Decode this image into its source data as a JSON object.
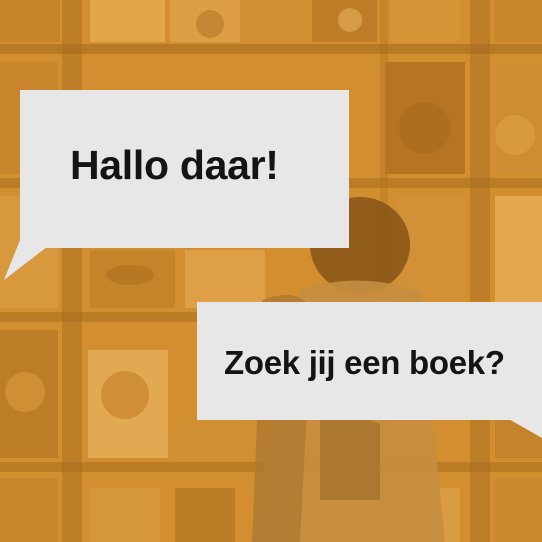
{
  "colors": {
    "background_tint": "#d99d40",
    "bubble_fill": "#e7e7e7",
    "bubble_text": "#141414"
  },
  "bubbles": [
    {
      "text": "Hallo daar!"
    },
    {
      "text": "Zoek jij een boek?"
    }
  ]
}
